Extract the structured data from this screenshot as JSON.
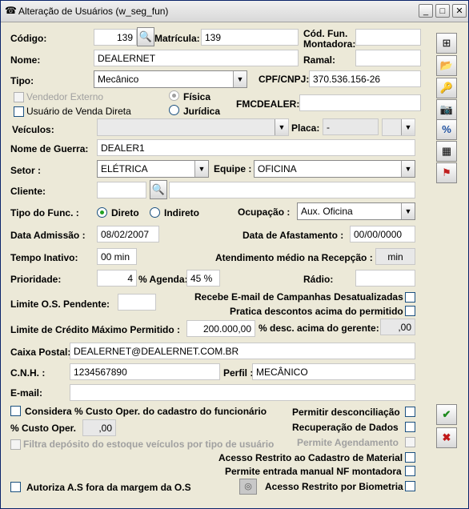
{
  "window": {
    "title": "Alteração de Usuários (w_seg_fun)",
    "minimize": "_",
    "maximize": "□",
    "close": "✕",
    "icon": "phone-icon"
  },
  "labels": {
    "codigo": "Código:",
    "matricula": "Matrícula:",
    "cod_fun_montadora_1": "Cód. Fun.",
    "cod_fun_montadora_2": "Montadora:",
    "nome": "Nome:",
    "ramal": "Ramal:",
    "tipo": "Tipo:",
    "cpf_cnpj": "CPF/CNPJ:",
    "vendedor_externo": "Vendedor Externo",
    "fisica": "Física",
    "juridica": "Jurídica",
    "usuario_venda_direta": "Usuário de Venda Direta",
    "fmcdealer": "FMCDEALER:",
    "veiculos": "Veículos:",
    "placa": "Placa:",
    "nome_guerra": "Nome de Guerra:",
    "setor": "Setor :",
    "equipe": "Equipe :",
    "cliente": "Cliente:",
    "tipo_func": "Tipo do Func. :",
    "direto": "Direto",
    "indireto": "Indireto",
    "ocupacao": "Ocupação :",
    "data_admissao": "Data Admissão :",
    "data_afastamento": "Data de Afastamento :",
    "tempo_inativo": "Tempo Inativo:",
    "atendimento_medio": "Atendimento médio na Recepção :",
    "prioridade": "Prioridade:",
    "pct_agenda": "% Agenda:",
    "radio": "Rádio:",
    "limite_os": "Limite O.S. Pendente:",
    "recebe_email": "Recebe E-mail de Campanhas Desatualizadas",
    "pratica_descontos": "Pratica descontos acima do permitido",
    "limite_credito": "Limite de Crédito Máximo Permitido :",
    "pct_desc_gerente": "% desc. acima do gerente:",
    "caixa_postal": "Caixa Postal:",
    "cnh": "C.N.H. :",
    "perfil": "Perfil :",
    "email": "E-mail:",
    "considera_custo": "Considera % Custo Oper. do cadastro do funcionário",
    "permitir_desconciliacao": "Permitir desconciliação",
    "pct_custo_oper": "% Custo Oper.",
    "recuperacao_dados": "Recuperação de Dados",
    "filtra_deposito": "Filtra depósito do estoque veículos por tipo de usuário",
    "permite_agendamento": "Permite Agendamento",
    "acesso_restrito_material": "Acesso Restrito ao Cadastro de Material",
    "permite_nf_montadora": "Permite entrada manual NF montadora",
    "autoriza_as": "Autoriza A.S fora da margem da O.S",
    "acesso_biometria": "Acesso Restrito por Biometria"
  },
  "values": {
    "codigo": "139",
    "matricula": "139",
    "cod_fun_montadora": "",
    "nome": "DEALERNET",
    "ramal": "",
    "tipo": "Mecânico",
    "cpf_cnpj": "370.536.156-26",
    "fmcdealer": "",
    "veiculos": "",
    "placa": "-",
    "nome_guerra": "DEALER1",
    "setor": "ELÉTRICA",
    "equipe": "OFICINA",
    "cliente_code": "",
    "cliente_name": "",
    "ocupacao": "Aux. Oficina",
    "data_admissao": "08/02/2007",
    "data_afastamento": "00/00/0000",
    "tempo_inativo": "00 min",
    "atendimento_medio": "min",
    "prioridade": "4",
    "pct_agenda": "45 %",
    "radio": "",
    "limite_os": "",
    "limite_credito": "200.000,00",
    "pct_desc_gerente": ",00",
    "caixa_postal": "DEALERNET@DEALERNET.COM.BR",
    "cnh": "1234567890",
    "perfil": "MECÂNICO",
    "email": "",
    "pct_custo_oper": ",00"
  },
  "side_toolbar": [
    {
      "name": "add-record-icon",
      "glyph": "⊞"
    },
    {
      "name": "open-folder-icon",
      "glyph": "📂"
    },
    {
      "name": "key-icon",
      "glyph": "🔑"
    },
    {
      "name": "camera-icon",
      "glyph": "📷"
    },
    {
      "name": "percent-icon",
      "glyph": "%"
    },
    {
      "name": "color-card-icon",
      "glyph": "▦"
    },
    {
      "name": "flags-icon",
      "glyph": "⚑"
    }
  ],
  "actions": {
    "confirm_glyph": "✔",
    "cancel_glyph": "✖"
  },
  "colors": {
    "accent_green": "#21a121",
    "accent_blue": "#1c5180"
  }
}
